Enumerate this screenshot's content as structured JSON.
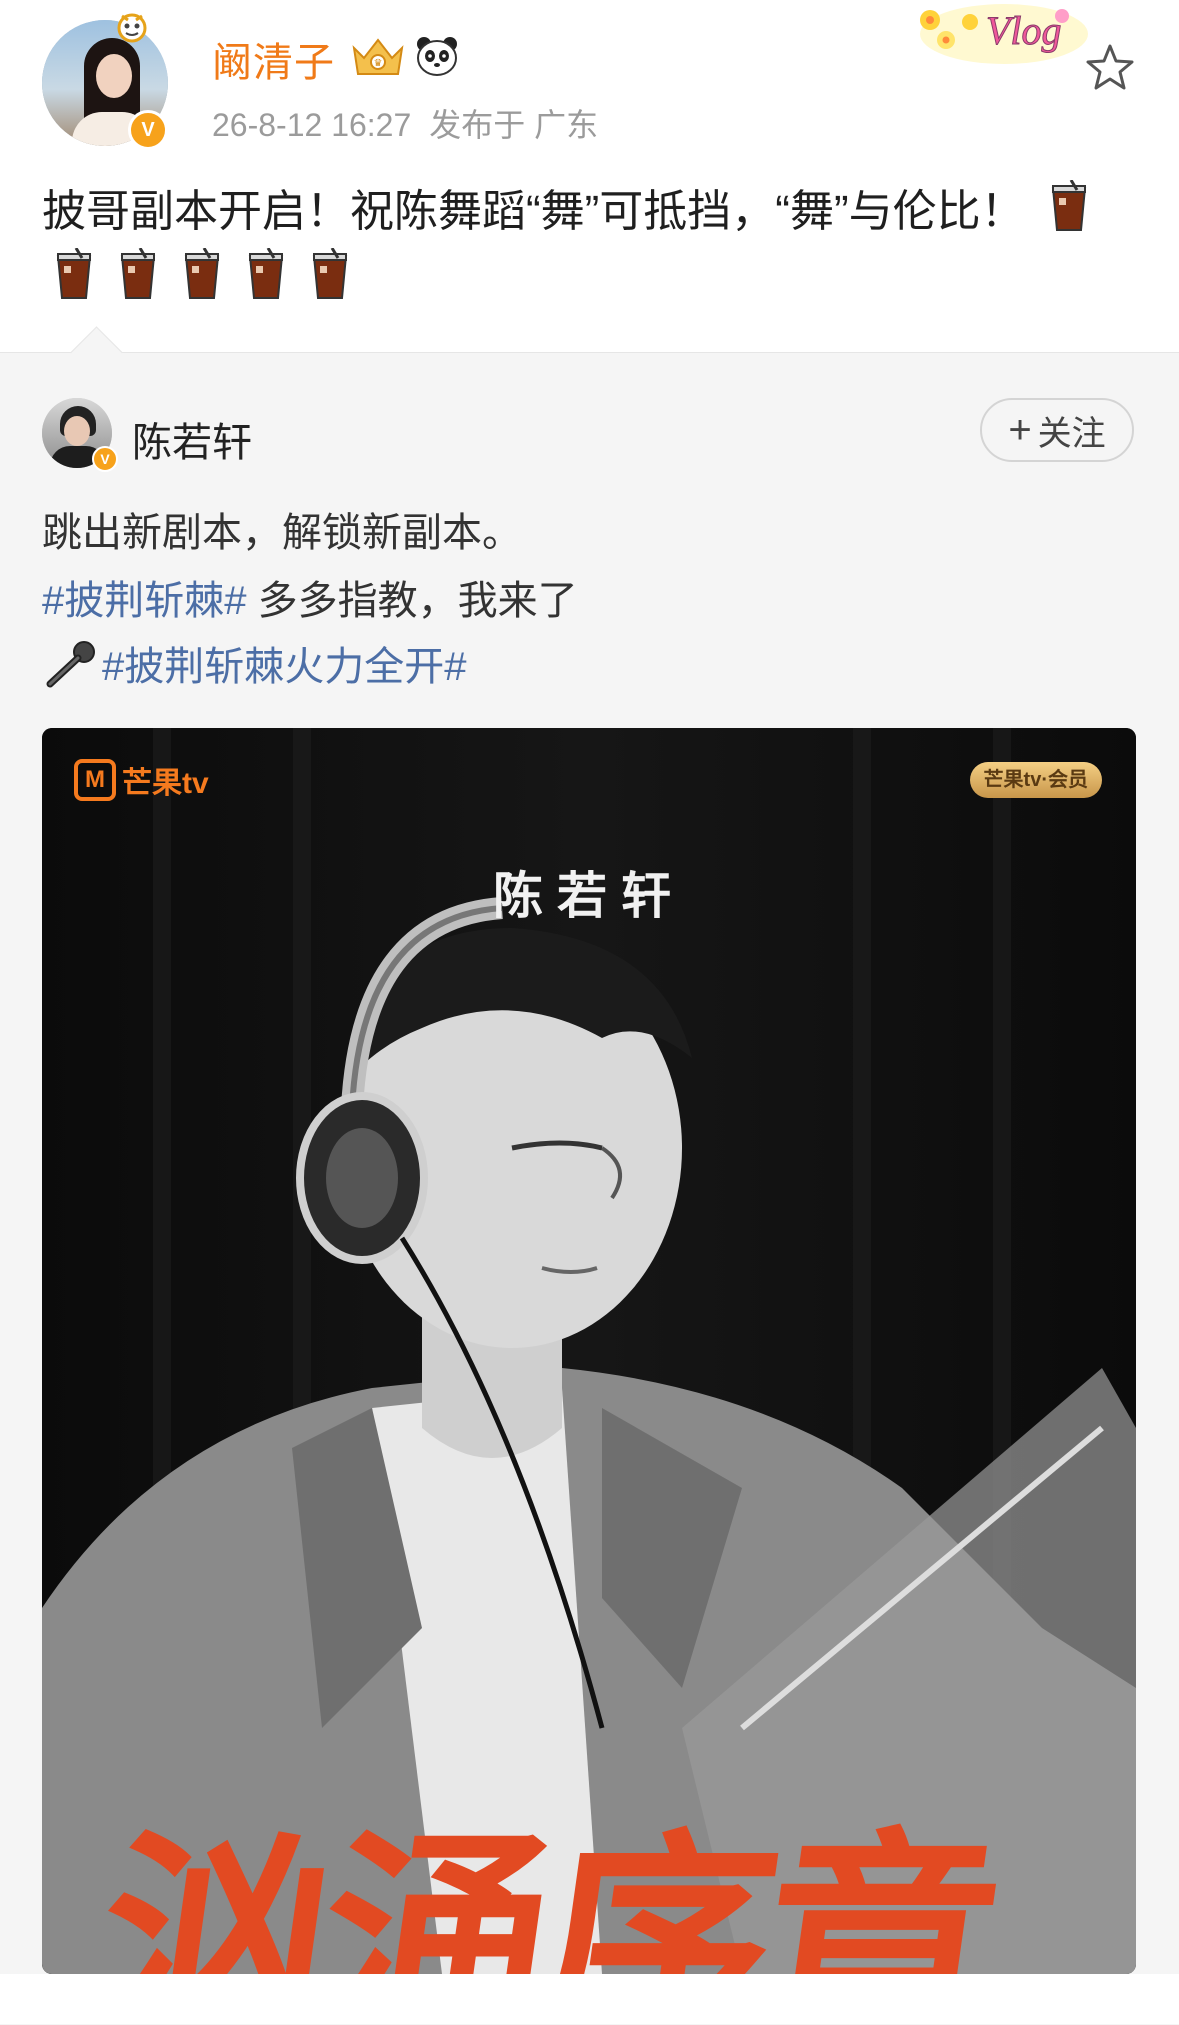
{
  "post": {
    "author": "阚清子",
    "timestamp": "26-8-12 16:27",
    "location": "发布于 广东",
    "text": "披哥副本开启！祝陈舞蹈“舞”可抵挡，“舞”与伦比！",
    "emoji_count": 6,
    "badges": [
      "vip-crown-icon",
      "panda-icon"
    ]
  },
  "retweet": {
    "author": "陈若轩",
    "follow_label": "关注",
    "line1": "跳出新剧本，解锁新副本。",
    "line2_hashtag": "#披荆斩棘#",
    "line2_text": " 多多指教，我来了",
    "line3_hashtag": "#披荆斩棘火力全开#"
  },
  "poster": {
    "brand": "芒果tv",
    "vip_label": "芒果tv·会员",
    "name": "陈若轩",
    "title": "汹涌序章"
  },
  "colors": {
    "username": "#f07a18",
    "hashtag": "#4c6ea6",
    "retweet_bg": "#f5f5f5",
    "poster_title": "#e24a22"
  }
}
